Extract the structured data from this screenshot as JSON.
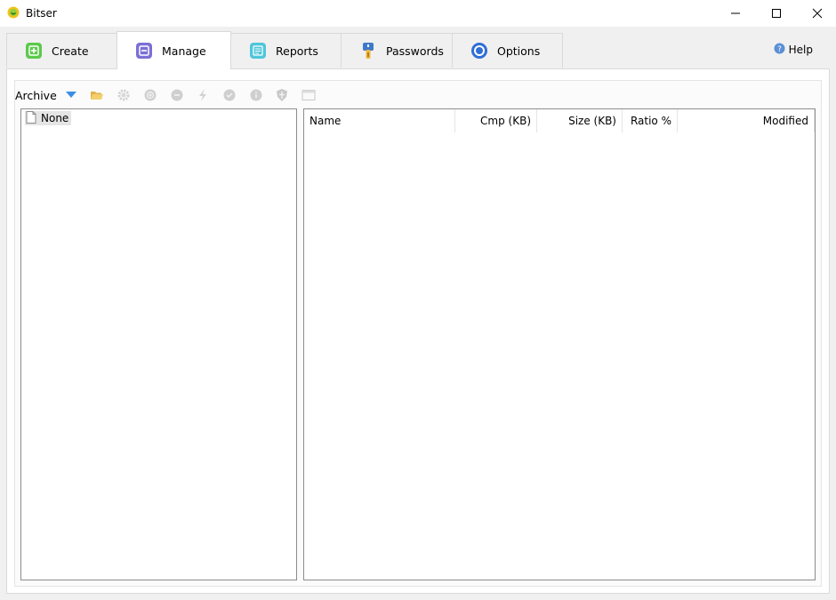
{
  "window": {
    "title": "Bitser",
    "controls": {
      "minimize": "—",
      "maximize": "☐",
      "close": "✕"
    }
  },
  "tabs": [
    {
      "label": "Create",
      "icon": "plus-square-icon",
      "color": "#5cc94b"
    },
    {
      "label": "Manage",
      "icon": "minus-square-icon",
      "color": "#7b6fd6",
      "active": true
    },
    {
      "label": "Reports",
      "icon": "report-icon",
      "color": "#4fc6d9"
    },
    {
      "label": "Passwords",
      "icon": "key-icon",
      "color": "#3f79c9"
    },
    {
      "label": "Options",
      "icon": "options-ring-icon",
      "color": "#2f6fd6"
    }
  ],
  "help": {
    "label": "Help"
  },
  "toolbar": {
    "label": "Archive",
    "icons": [
      "dropdown-arrow-icon",
      "open-folder-icon",
      "settings-gear-icon",
      "add-icon",
      "remove-icon",
      "extract-icon",
      "test-icon",
      "info-icon",
      "shield-icon",
      "window-icon"
    ]
  },
  "tree": {
    "items": [
      {
        "label": "None"
      }
    ]
  },
  "list": {
    "columns": [
      {
        "label": "Name",
        "align": "left"
      },
      {
        "label": "Cmp (KB)",
        "align": "right"
      },
      {
        "label": "Size (KB)",
        "align": "right"
      },
      {
        "label": "Ratio %",
        "align": "right"
      },
      {
        "label": "Modified",
        "align": "right"
      }
    ]
  }
}
